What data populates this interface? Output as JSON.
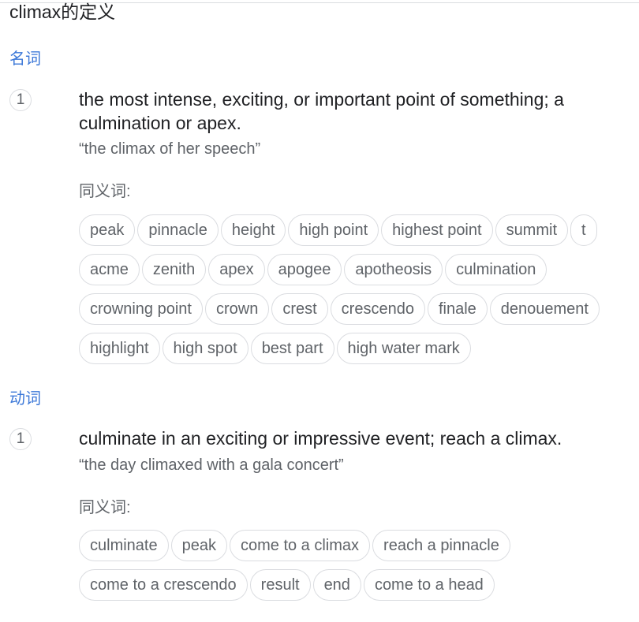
{
  "title": "climax的定义",
  "senses": [
    {
      "pos": "名词",
      "number": "1",
      "definition": "the most intense, exciting, or important point of something; a culmination or apex.",
      "example": "“the climax of her speech”",
      "synonyms_label": "同义词:",
      "synonym_rows": [
        [
          "peak",
          "pinnacle",
          "height",
          "high point",
          "highest point",
          "summit",
          "t"
        ],
        [
          "acme",
          "zenith",
          "apex",
          "apogee",
          "apotheosis",
          "culmination"
        ],
        [
          "crowning point",
          "crown",
          "crest",
          "crescendo",
          "finale",
          "denouement"
        ],
        [
          "highlight",
          "high spot",
          "best part",
          "high water mark"
        ]
      ]
    },
    {
      "pos": "动词",
      "number": "1",
      "definition": "culminate in an exciting or impressive event; reach a climax.",
      "example": "“the day climaxed with a gala concert”",
      "synonyms_label": "同义词:",
      "synonym_rows": [
        [
          "culminate",
          "peak",
          "come to a climax",
          "reach a pinnacle"
        ],
        [
          "come to a crescendo",
          "result",
          "end",
          "come to a head"
        ]
      ]
    }
  ]
}
